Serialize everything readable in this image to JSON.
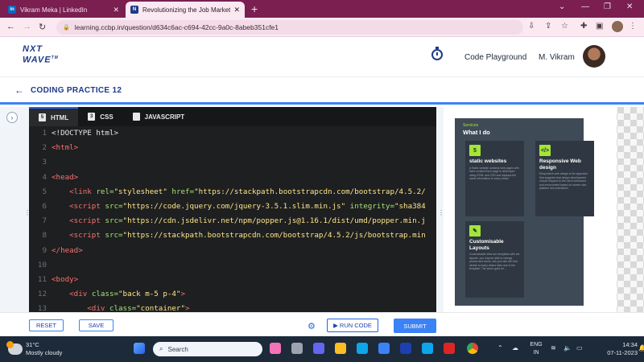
{
  "browser": {
    "tabs": [
      {
        "label": "Vikram Meka | LinkedIn",
        "favicon": "in"
      },
      {
        "label": "Revolutionizing the Job Market |",
        "favicon": "N"
      }
    ],
    "url": "learning.ccbp.in/question/d634c6ac-c694-42cc-9a0c-8abeb351cfe1"
  },
  "header": {
    "logo_line1": "NXT",
    "logo_line2": "WAVE",
    "playground_label": "Code Playground",
    "username": "M. Vikram"
  },
  "practice": {
    "title": "CODING PRACTICE 12"
  },
  "editor": {
    "tabs": [
      {
        "label": "HTML",
        "icon": "5"
      },
      {
        "label": "CSS",
        "icon": "3"
      },
      {
        "label": "JAVASCRIPT",
        "icon": ""
      }
    ],
    "lines": [
      {
        "n": "1",
        "segs": [
          [
            "",
            "<!DOCTYPE html>"
          ]
        ]
      },
      {
        "n": "2",
        "segs": [
          [
            "tg",
            "<html>"
          ]
        ]
      },
      {
        "n": "3",
        "segs": [
          [
            "",
            ""
          ]
        ]
      },
      {
        "n": "4",
        "segs": [
          [
            "tg",
            "<head>"
          ]
        ]
      },
      {
        "n": "5",
        "segs": [
          [
            "",
            "    "
          ],
          [
            "tg",
            "<link "
          ],
          [
            "at",
            "rel="
          ],
          [
            "st",
            "\"stylesheet\" "
          ],
          [
            "at",
            "href="
          ],
          [
            "st",
            "\"https://stackpath.bootstrapcdn.com/bootstrap/4.5.2/"
          ]
        ]
      },
      {
        "n": "6",
        "segs": [
          [
            "",
            "    "
          ],
          [
            "tg",
            "<script "
          ],
          [
            "at",
            "src="
          ],
          [
            "st",
            "\"https://code.jquery.com/jquery-3.5.1.slim.min.js\" "
          ],
          [
            "at",
            "integrity="
          ],
          [
            "st",
            "\"sha384"
          ]
        ]
      },
      {
        "n": "7",
        "segs": [
          [
            "",
            "    "
          ],
          [
            "tg",
            "<script "
          ],
          [
            "at",
            "src="
          ],
          [
            "st",
            "\"https://cdn.jsdelivr.net/npm/popper.js@1.16.1/dist/umd/popper.min.j"
          ]
        ]
      },
      {
        "n": "8",
        "segs": [
          [
            "",
            "    "
          ],
          [
            "tg",
            "<script "
          ],
          [
            "at",
            "src="
          ],
          [
            "st",
            "\"https://stackpath.bootstrapcdn.com/bootstrap/4.5.2/js/bootstrap.min"
          ]
        ]
      },
      {
        "n": "9",
        "segs": [
          [
            "tg",
            "</head>"
          ]
        ]
      },
      {
        "n": "10",
        "segs": [
          [
            "",
            ""
          ]
        ]
      },
      {
        "n": "11",
        "segs": [
          [
            "tg",
            "<body>"
          ]
        ]
      },
      {
        "n": "12",
        "segs": [
          [
            "",
            "    "
          ],
          [
            "tg",
            "<div "
          ],
          [
            "at",
            "class="
          ],
          [
            "st",
            "\"back m-5 p-4\""
          ],
          [
            "tg",
            ">"
          ]
        ]
      },
      {
        "n": "13",
        "segs": [
          [
            "",
            "        "
          ],
          [
            "tg",
            "<div "
          ],
          [
            "at",
            "class="
          ],
          [
            "st",
            "\"container\""
          ],
          [
            "tg",
            ">"
          ]
        ]
      }
    ]
  },
  "preview": {
    "label": "Services",
    "title": "What I do",
    "cards": [
      {
        "icon": "5",
        "title": "static websites",
        "desc": "A Static website contains web pages with fixed content.Each page is developed using HTML and CSS and displays the same information to every visitor."
      },
      {
        "icon": "</>",
        "title": "Responsive Web design",
        "desc": "Responsive web design is the approach that suggests that design development should respond to the user's behaviour and environment based on screen size, platform and orientation."
      },
      {
        "icon": "✎",
        "title": "Customisable Layouts",
        "desc": "Customisable sites are templates with set layouts, you may be able to change photos and colors, but your site will look similar to many others sites due to the template. The same goes for..."
      }
    ]
  },
  "controls": {
    "reset": "RESET",
    "save": "SAVE",
    "run": "RUN CODE",
    "submit": "SUBMIT"
  },
  "taskbar": {
    "temp": "31°C",
    "weather": "Mostly cloudy",
    "search": "Search",
    "lang1": "ENG",
    "lang2": "IN",
    "time": "14:34",
    "date": "07-11-2023"
  },
  "colors": {
    "accent": "#3b82f6",
    "brand": "#1e3a8a",
    "browser_frame": "#7a1f4f",
    "editor_bg": "#1e1f20",
    "preview_bg": "#3f4a57",
    "lime": "#a3e635"
  }
}
